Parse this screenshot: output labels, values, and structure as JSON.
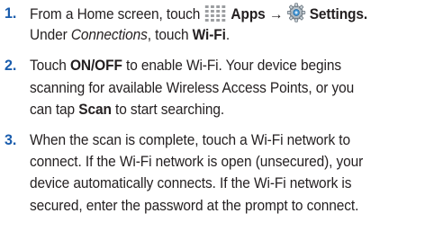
{
  "steps": [
    {
      "number": "1.",
      "lines": {
        "l1": {
          "pre": "From a Home screen, touch ",
          "apps": "Apps",
          "arrow": "→",
          "settings": "Settings",
          "end": "."
        },
        "l2": {
          "pre": "Under ",
          "connections": "Connections",
          "mid": ", touch ",
          "wifi": "Wi-Fi",
          "end": "."
        }
      }
    },
    {
      "number": "2.",
      "lines": {
        "l1": {
          "pre": "Touch ",
          "onoff": "ON/OFF",
          "post": " to enable Wi-Fi. Your device begins"
        },
        "l2": "scanning for available Wireless Access Points, or you",
        "l3": {
          "pre": "can tap ",
          "scan": "Scan",
          "post": " to start searching."
        }
      }
    },
    {
      "number": "3.",
      "lines": {
        "l1": "When the scan is complete, touch a Wi-Fi network to",
        "l2": "connect. If the Wi-Fi network is open (unsecured), your",
        "l3": "device automatically connects. If the Wi-Fi network is",
        "l4": "secured, enter the password at the prompt to connect."
      }
    }
  ],
  "icons": {
    "apps": "apps-grid-icon",
    "settings": "settings-gear-icon"
  },
  "colors": {
    "step_number": "#1a5dad",
    "text": "#231f20"
  }
}
